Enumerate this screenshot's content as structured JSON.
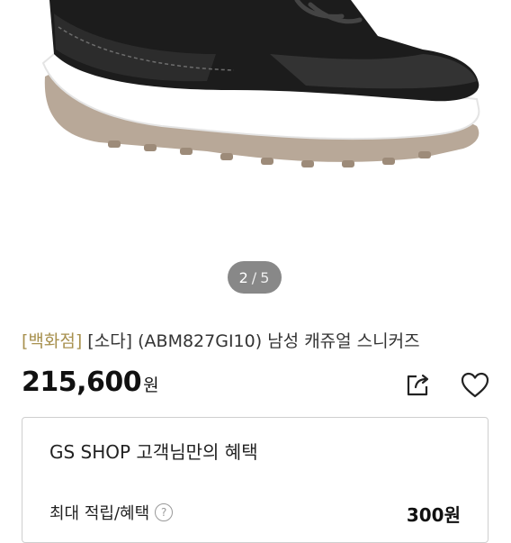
{
  "product": {
    "image_icon": "sneaker-photo",
    "pager": {
      "current": "2",
      "separator": "/",
      "total": "5"
    },
    "title_tag": "[백화점]",
    "title_text": " [소다] (ABM827GI10) 남성 캐쥬얼 스니커즈",
    "price_value": "215,600",
    "price_unit": "원",
    "share_icon": "share-icon",
    "wishlist_icon": "heart-icon"
  },
  "benefit": {
    "title": "GS SHOP 고객님만의 혜택",
    "row_label": "최대 적립/혜택",
    "row_value": "300원"
  },
  "colors": {
    "tag": "#a8914f",
    "pager_bg": "#5a5a5a"
  }
}
